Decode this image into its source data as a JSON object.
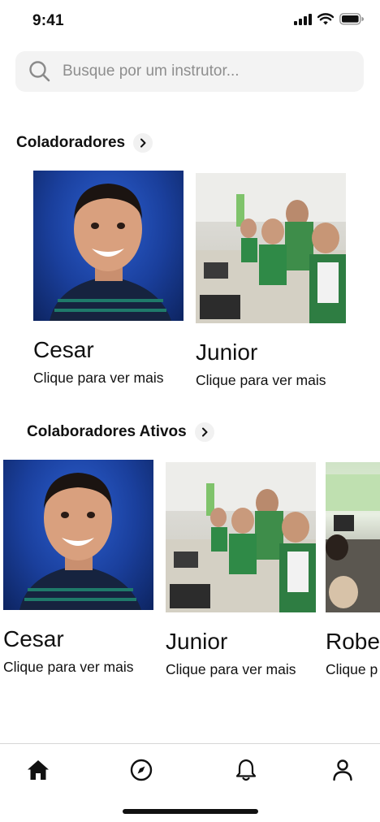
{
  "status": {
    "time": "9:41"
  },
  "search": {
    "placeholder": "Busque por um instrutor..."
  },
  "section1": {
    "title": "Coladoradores",
    "cards": [
      {
        "name": "Cesar",
        "subtitle": "Clique para ver mais",
        "photo": "portrait"
      },
      {
        "name": "Junior",
        "subtitle": "Clique para ver mais",
        "photo": "classroom"
      }
    ]
  },
  "section2": {
    "title": "Colaboradores Ativos",
    "cards": [
      {
        "name": "Cesar",
        "subtitle": "Clique para ver mais",
        "photo": "portrait"
      },
      {
        "name": "Junior",
        "subtitle": "Clique para ver mais",
        "photo": "classroom"
      },
      {
        "name": "Robe",
        "subtitle": "Clique p",
        "photo": "lab"
      }
    ]
  },
  "tabbar": {
    "items": [
      {
        "icon": "home-icon"
      },
      {
        "icon": "compass-icon"
      },
      {
        "icon": "bell-icon"
      },
      {
        "icon": "user-icon"
      }
    ]
  }
}
